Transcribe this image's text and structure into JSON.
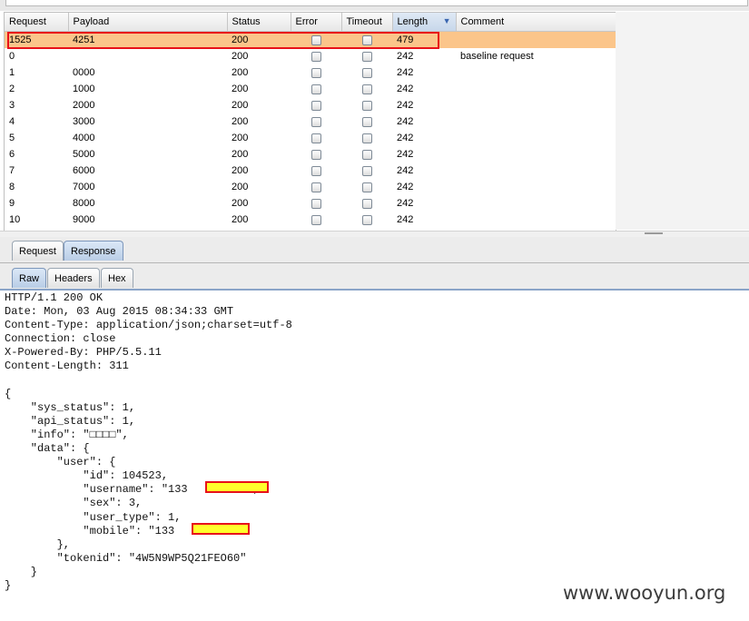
{
  "table": {
    "columns": [
      "Request",
      "Payload",
      "Status",
      "Error",
      "Timeout",
      "Length",
      "Comment"
    ],
    "sorted_column": "Length",
    "selected_row": 0,
    "rows": [
      {
        "request": "1525",
        "payload": "4251",
        "status": "200",
        "error": false,
        "timeout": false,
        "length": "479",
        "comment": ""
      },
      {
        "request": "0",
        "payload": "",
        "status": "200",
        "error": false,
        "timeout": false,
        "length": "242",
        "comment": "baseline request"
      },
      {
        "request": "1",
        "payload": "0000",
        "status": "200",
        "error": false,
        "timeout": false,
        "length": "242",
        "comment": ""
      },
      {
        "request": "2",
        "payload": "1000",
        "status": "200",
        "error": false,
        "timeout": false,
        "length": "242",
        "comment": ""
      },
      {
        "request": "3",
        "payload": "2000",
        "status": "200",
        "error": false,
        "timeout": false,
        "length": "242",
        "comment": ""
      },
      {
        "request": "4",
        "payload": "3000",
        "status": "200",
        "error": false,
        "timeout": false,
        "length": "242",
        "comment": ""
      },
      {
        "request": "5",
        "payload": "4000",
        "status": "200",
        "error": false,
        "timeout": false,
        "length": "242",
        "comment": ""
      },
      {
        "request": "6",
        "payload": "5000",
        "status": "200",
        "error": false,
        "timeout": false,
        "length": "242",
        "comment": ""
      },
      {
        "request": "7",
        "payload": "6000",
        "status": "200",
        "error": false,
        "timeout": false,
        "length": "242",
        "comment": ""
      },
      {
        "request": "8",
        "payload": "7000",
        "status": "200",
        "error": false,
        "timeout": false,
        "length": "242",
        "comment": ""
      },
      {
        "request": "9",
        "payload": "8000",
        "status": "200",
        "error": false,
        "timeout": false,
        "length": "242",
        "comment": ""
      },
      {
        "request": "10",
        "payload": "9000",
        "status": "200",
        "error": false,
        "timeout": false,
        "length": "242",
        "comment": ""
      }
    ]
  },
  "viewer_tabs": {
    "request_label": "Request",
    "response_label": "Response",
    "active": "Response"
  },
  "format_tabs": {
    "raw_label": "Raw",
    "headers_label": "Headers",
    "hex_label": "Hex",
    "active": "Raw"
  },
  "response_body": "HTTP/1.1 200 OK\nDate: Mon, 03 Aug 2015 08:34:33 GMT\nContent-Type: application/json;charset=utf-8\nConnection: close\nX-Powered-By: PHP/5.5.11\nContent-Length: 311\n\n{\n    \"sys_status\": 1,\n    \"api_status\": 1,\n    \"info\": \"□□□□\",\n    \"data\": {\n        \"user\": {\n            \"id\": 104523,\n            \"username\": \"133         \",\n            \"sex\": 3,\n            \"user_type\": 1,\n            \"mobile\": \"133        \"\n        },\n        \"tokenid\": \"4W5N9WP5Q21FEO60\"\n    }\n}",
  "watermark": "www.wooyun.org",
  "colors": {
    "selected_row": "#fbc58a",
    "highlight_border": "#e8111a",
    "redaction_fill": "#ffff2b",
    "sort_arrow": "#3a66b0"
  }
}
